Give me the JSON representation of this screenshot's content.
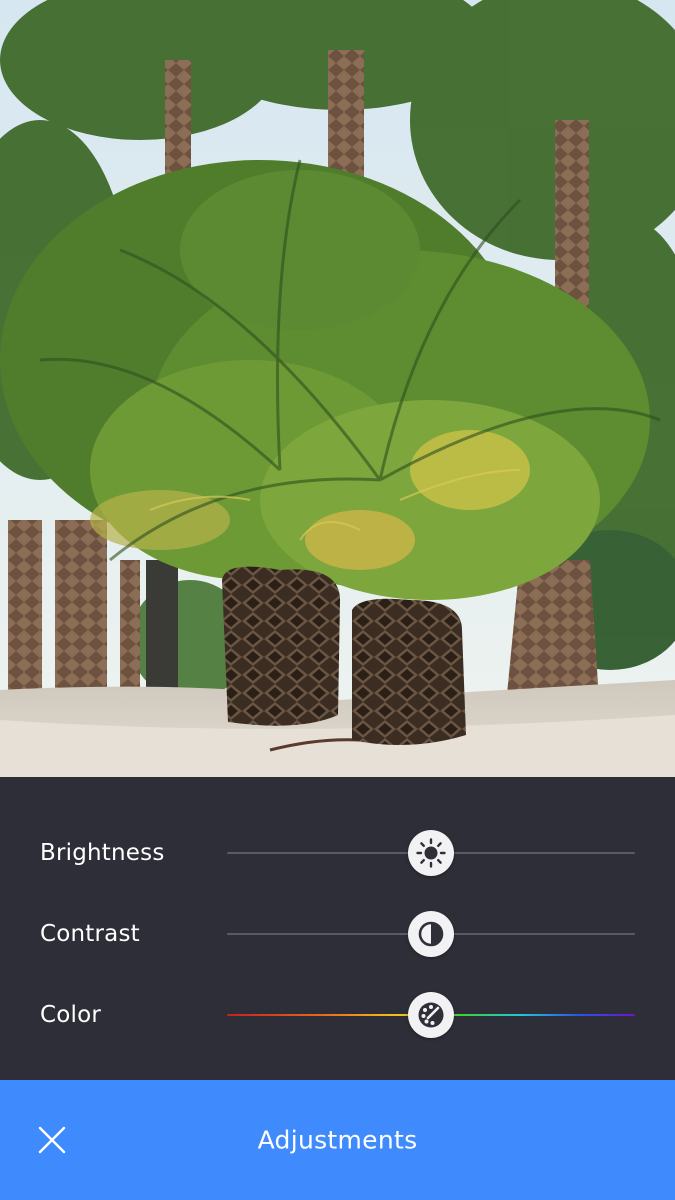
{
  "photo": {
    "subject": "palm-trees-photo",
    "colors": {
      "sky": "#dde9ef",
      "foliage": "#5e8a2a",
      "foliage_light": "#b8c24a",
      "trunk": "#4a3a2c",
      "sand": "#d9d2c8"
    }
  },
  "adjustments": {
    "items": [
      {
        "label": "Brightness",
        "icon": "sun-icon",
        "value": 0.5
      },
      {
        "label": "Contrast",
        "icon": "contrast-icon",
        "value": 0.5
      },
      {
        "label": "Color",
        "icon": "palette-icon",
        "value": 0.5
      }
    ]
  },
  "bottom_bar": {
    "title": "Adjustments",
    "close_icon": "close-icon"
  },
  "colors": {
    "panel_bg": "#2e2e38",
    "bar_bg": "#3f8bfd",
    "track": "#5a5a64",
    "knob": "#f2f2f4"
  }
}
